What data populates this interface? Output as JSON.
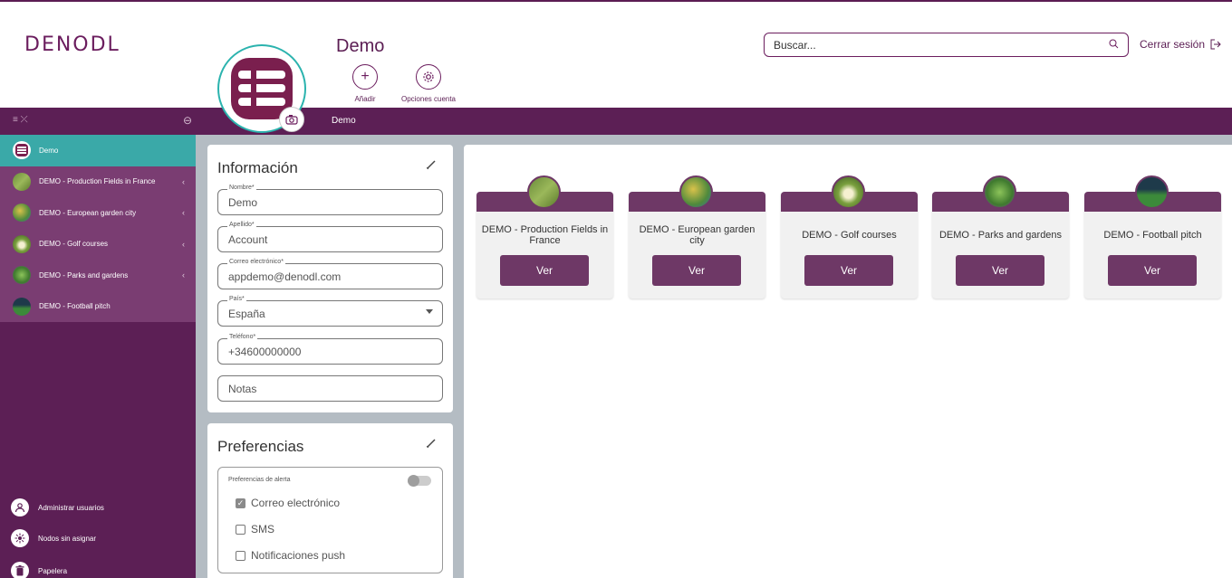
{
  "header": {
    "logo": "DENODL",
    "account_title": "Demo",
    "add_label": "Añadir",
    "account_options_label": "Opciones cuenta",
    "search_placeholder": "Buscar...",
    "logout_label": "Cerrar sesión"
  },
  "topbar": {
    "breadcrumb": "Demo"
  },
  "sidebar": {
    "items": [
      {
        "label": "Demo",
        "icon": "denodl-logo-icon",
        "active": true,
        "expandable": false
      },
      {
        "label": "DEMO - Production Fields in France",
        "icon": "field-thumbnail",
        "expandable": true
      },
      {
        "label": "DEMO - European garden city",
        "icon": "garden-thumbnail",
        "expandable": true
      },
      {
        "label": "DEMO - Golf courses",
        "icon": "golf-thumbnail",
        "expandable": true
      },
      {
        "label": "DEMO - Parks and gardens",
        "icon": "park-thumbnail",
        "expandable": true
      },
      {
        "label": "DEMO - Football pitch",
        "icon": "football-thumbnail",
        "expandable": false
      }
    ],
    "bottom": [
      {
        "label": "Administrar usuarios",
        "icon": "users-icon"
      },
      {
        "label": "Nodos sin asignar",
        "icon": "node-icon"
      },
      {
        "label": "Papelera",
        "icon": "trash-icon"
      }
    ]
  },
  "info": {
    "title": "Información",
    "fields": {
      "name": {
        "label": "Nombre*",
        "value": "Demo"
      },
      "surname": {
        "label": "Apellido*",
        "value": "Account"
      },
      "email": {
        "label": "Correo electrónico*",
        "value": "appdemo@denodl.com"
      },
      "country": {
        "label": "País*",
        "value": "España"
      },
      "phone": {
        "label": "Teléfono*",
        "value": "+34600000000"
      },
      "notes": {
        "placeholder": "Notas"
      }
    }
  },
  "preferences": {
    "title": "Preferencias",
    "alerts_title": "Preferencias de alerta",
    "alerts_enabled": false,
    "options": [
      {
        "label": "Correo electrónico",
        "checked": true
      },
      {
        "label": "SMS",
        "checked": false
      },
      {
        "label": "Notificaciones push",
        "checked": false
      }
    ]
  },
  "nodes": [
    {
      "title": "DEMO - Production Fields in France",
      "button": "Ver"
    },
    {
      "title": "DEMO - European garden city",
      "button": "Ver"
    },
    {
      "title": "DEMO - Golf courses",
      "button": "Ver"
    },
    {
      "title": "DEMO - Parks and gardens",
      "button": "Ver"
    },
    {
      "title": "DEMO - Football pitch",
      "button": "Ver"
    }
  ],
  "colors": {
    "brand_purple": "#5c1f55",
    "sidebar_list": "#7a3d72",
    "active_teal": "#3aa9a8",
    "card_button": "#6e3866"
  }
}
